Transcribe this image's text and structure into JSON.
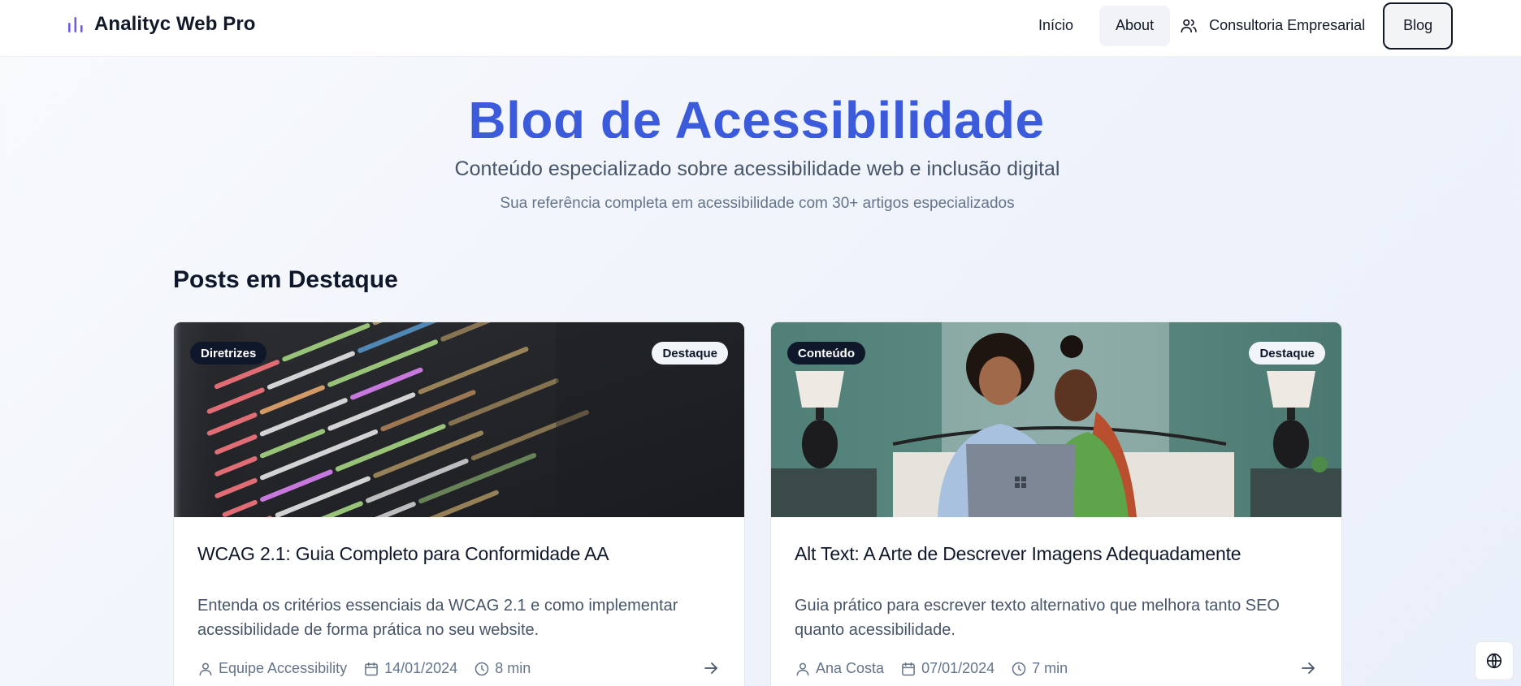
{
  "header": {
    "brand": "Analityc Web Pro",
    "nav": [
      {
        "label": "Início"
      },
      {
        "label": "About"
      },
      {
        "label": "Consultoria Empresarial"
      },
      {
        "label": "Blog"
      }
    ]
  },
  "hero": {
    "title": "Blog de Acessibilidade",
    "subtitle": "Conteúdo especializado sobre acessibilidade web e inclusão digital",
    "note": "Sua referência completa em acessibilidade com 30+ artigos especializados"
  },
  "featured": {
    "heading": "Posts em Destaque",
    "posts": [
      {
        "category": "Diretrizes",
        "badge": "Destaque",
        "title": "WCAG 2.1: Guia Completo para Conformidade AA",
        "description": "Entenda os critérios essenciais da WCAG 2.1 e como implementar acessibilidade de forma prática no seu website.",
        "author": "Equipe Accessibility",
        "date": "14/01/2024",
        "read_time": "8 min",
        "image": "code-on-screen"
      },
      {
        "category": "Conteúdo",
        "badge": "Destaque",
        "title": "Alt Text: A Arte de Descrever Imagens Adequadamente",
        "description": "Guia prático para escrever texto alternativo que melhora tanto SEO quanto acessibilidade.",
        "author": "Ana Costa",
        "date": "07/01/2024",
        "read_time": "7 min",
        "image": "two-women-with-laptop"
      }
    ]
  },
  "colors": {
    "accent": "#3b5bdb",
    "brand_icon": "#6d5ce8",
    "badge_dark": "#0f172a"
  },
  "icons": {
    "brand": "bar-chart-icon",
    "consult": "users-icon",
    "author": "user-icon",
    "date": "calendar-icon",
    "time": "clock-icon",
    "more": "arrow-right-icon",
    "language": "globe-icon"
  }
}
